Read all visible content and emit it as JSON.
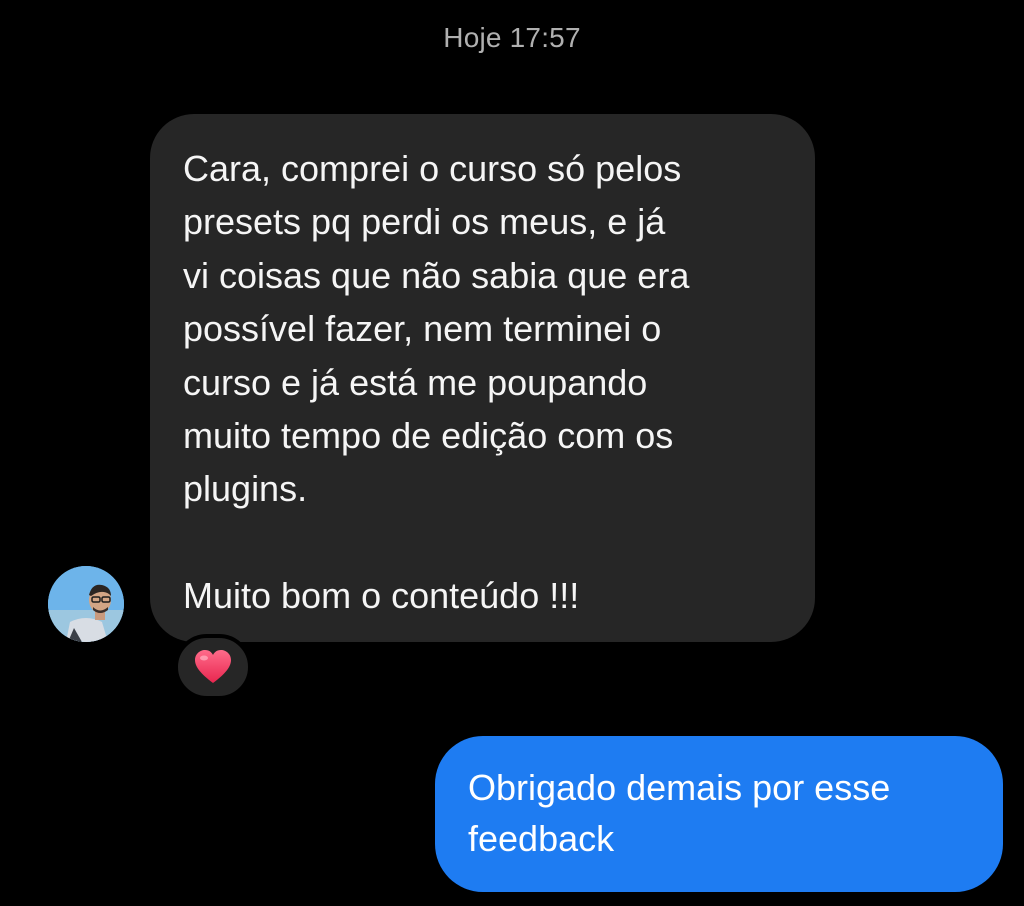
{
  "header": {
    "timestamp": "Hoje 17:57"
  },
  "messages": {
    "incoming": {
      "text": "Cara, comprei o curso só pelos\npresets pq perdi os meus, e já\nvi coisas que não sabia que era\npossível fazer, nem terminei o\ncurso e já está me poupando\nmuito tempo de edição com os\nplugins.",
      "closing": "Muito bom o conteúdo !!!",
      "reaction_icon": "heart-icon",
      "reaction_color": "#ff3b5f",
      "bubble_color": "#262626"
    },
    "outgoing": {
      "text": "Obrigado demais por esse\nfeedback",
      "bubble_color": "#1e7cf2"
    }
  }
}
